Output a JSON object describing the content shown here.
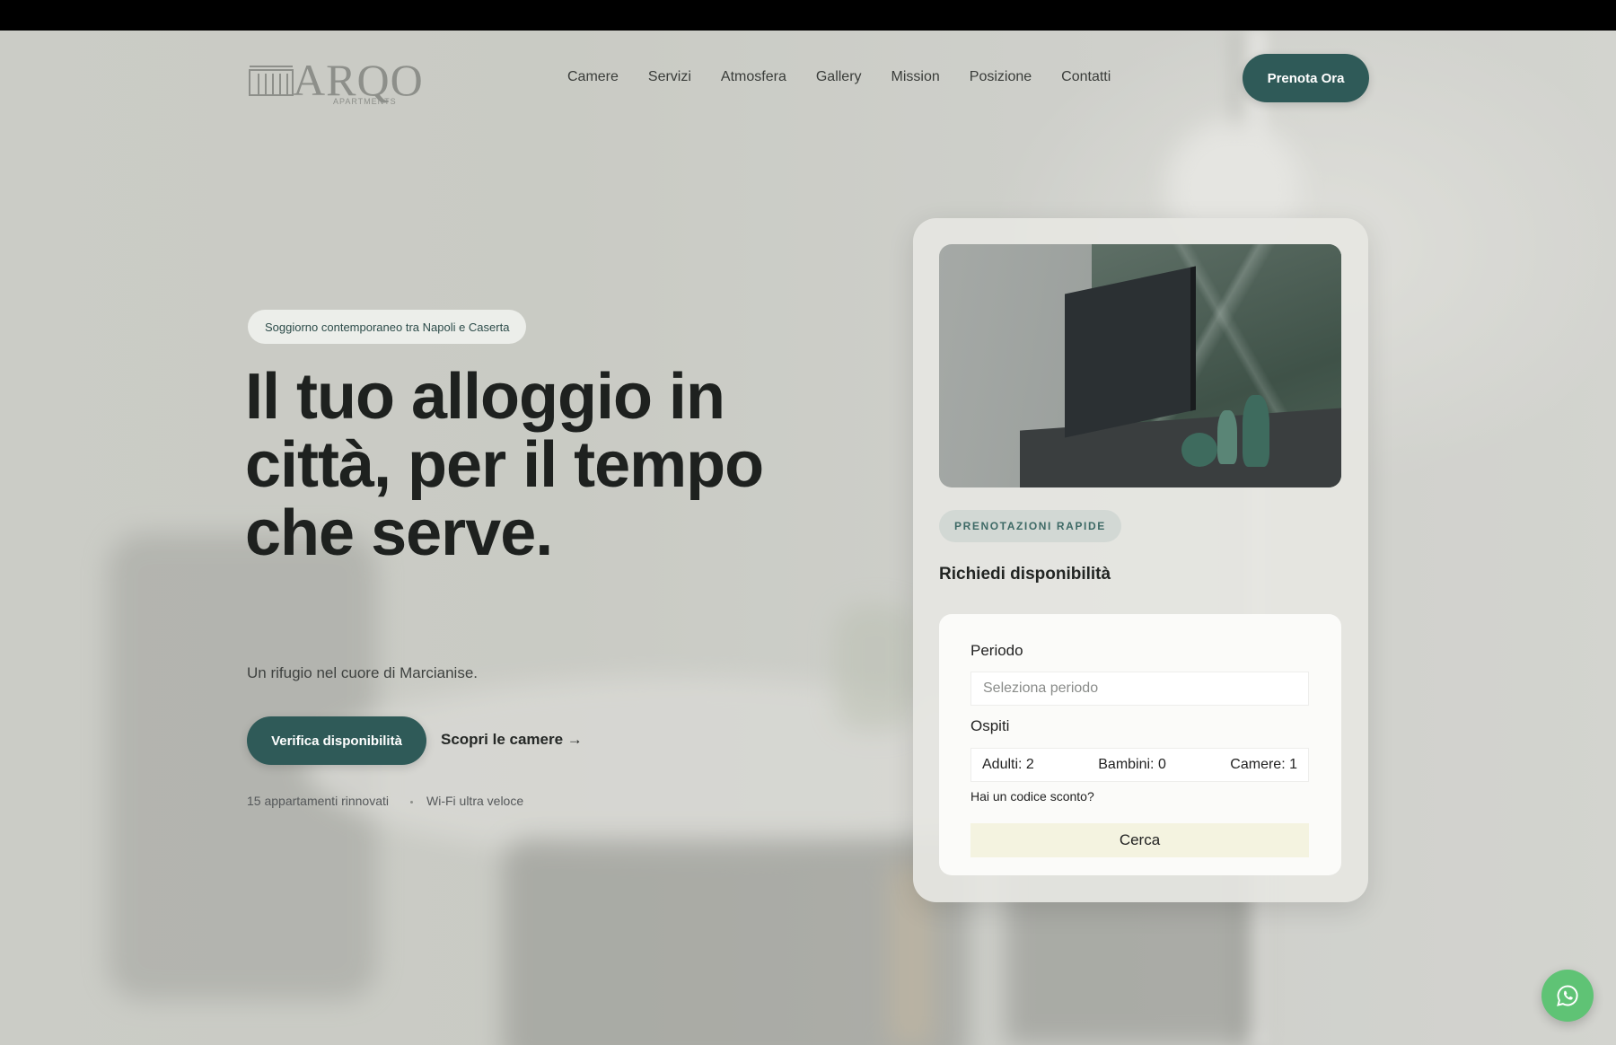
{
  "header": {
    "logo_word": "ARQO",
    "logo_sub": "APARTMENTS",
    "nav": [
      "Camere",
      "Servizi",
      "Atmosfera",
      "Gallery",
      "Mission",
      "Posizione",
      "Contatti"
    ],
    "cta": "Prenota Ora"
  },
  "hero": {
    "tagline": "Soggiorno contemporaneo tra Napoli e Caserta",
    "title": "Il tuo alloggio in città, per il tempo che serve.",
    "subtitle": "Un rifugio nel cuore di Marcianise.",
    "primary_cta": "Verifica disponibilità",
    "secondary_cta": "Scopri le camere →",
    "features": [
      "15 appartamenti rinnovati",
      "Wi-Fi ultra veloce"
    ]
  },
  "booking": {
    "badge": "PRENOTAZIONI RAPIDE",
    "heading": "Richiedi disponibilità",
    "period_label": "Periodo",
    "period_placeholder": "Seleziona periodo",
    "guests_label": "Ospiti",
    "adults": "Adulti: 2",
    "children": "Bambini: 0",
    "rooms": "Camere: 1",
    "discount": "Hai un codice sconto?",
    "search": "Cerca"
  },
  "colors": {
    "brand": "#2f5a58",
    "search_button": "#f4f3e0",
    "whatsapp": "#5fc375"
  },
  "icons": {
    "floating": "whatsapp-icon"
  }
}
